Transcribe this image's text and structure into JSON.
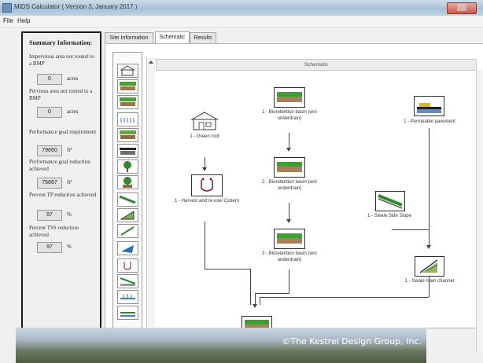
{
  "window": {
    "title": "MIDS Calculator ( Version 3, January 2017 )"
  },
  "menu": {
    "file": "File",
    "help": "Help"
  },
  "summary": {
    "heading": "Summary Information:",
    "imperv_label": "Impervious area not routed to a BMP",
    "imperv_value": "0",
    "imperv_unit": "acres",
    "perv_label": "Pervious area not routed to a BMP",
    "perv_value": "0",
    "perv_unit": "acres",
    "goal_label": "Performance goal requirement",
    "goal_value": "79860",
    "goal_unit": "ft³",
    "reduction_label": "Performance goal reduction achieved",
    "reduction_value": "75867",
    "reduction_unit": "ft³",
    "tp_label": "Percent TP reduction achieved",
    "tp_value": "97",
    "tp_unit": "%",
    "tss_label": "Percent TSS reduction achieved",
    "tss_value": "97",
    "tss_unit": "%"
  },
  "tabs": [
    "Site Information",
    "Schematic",
    "Results"
  ],
  "canvas": {
    "title": "Schematic"
  },
  "nodes": {
    "green_roof": "1 - Green roof",
    "bio1": "1 - Bioretention basin (w/o underdrain)",
    "bio2": "2 - Bioretention basin (w/o underdrain)",
    "bio3": "3 - Bioretention basin (w/o underdrain)",
    "harvest": "1 - Harvest and re-use/ Cistern",
    "perm_pave": "1 - Permeable pavement",
    "swale_side": "1 - Swale Side Slope",
    "swale_main": "1 - Swale main channel"
  },
  "footer": {
    "credit": "©The Kestrel Design Group, Inc."
  }
}
